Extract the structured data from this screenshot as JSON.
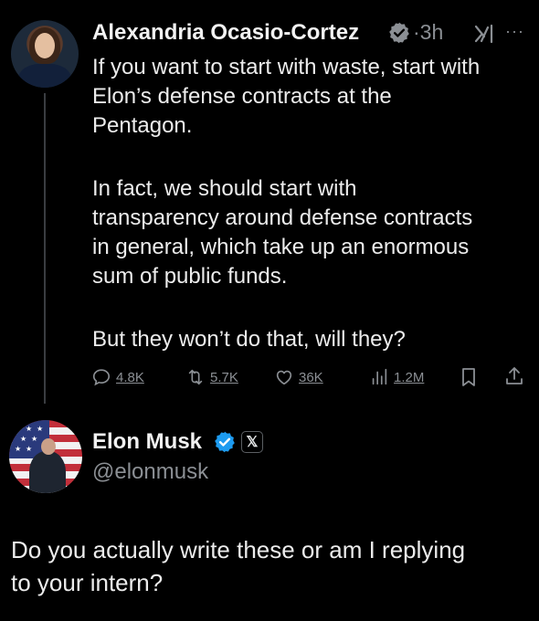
{
  "tweet": {
    "author_name": "Alexandria Ocasio-Cortez",
    "time": "·3h",
    "more_label": "···",
    "paragraphs": [
      "If you want to start with waste, start with\nElon’s defense contracts at the\nPentagon.",
      "In fact, we should start with\ntransparency around defense contracts\nin general, which take up an enormous\nsum of public funds.",
      "But they won’t do that, will they?"
    ],
    "metrics": {
      "replies": "4.8K",
      "reposts": "5.7K",
      "likes": "36K",
      "views": "1.2M"
    },
    "icons": [
      "verified-gray-icon",
      "grok-icon",
      "more-icon",
      "reply-icon",
      "repost-icon",
      "like-icon",
      "views-icon",
      "bookmark-icon",
      "share-icon"
    ],
    "colors": {
      "verified": "#8b8f94",
      "muted": "#8b8f94"
    }
  },
  "reply": {
    "author_name": "Elon Musk",
    "handle": "@elonmusk",
    "badge_label": "𝕏",
    "text": "Do you actually write these or am I replying\nto your intern?",
    "icons": [
      "verified-blue-icon",
      "x-affiliation-icon"
    ],
    "colors": {
      "verified": "#1d9bf0"
    }
  }
}
